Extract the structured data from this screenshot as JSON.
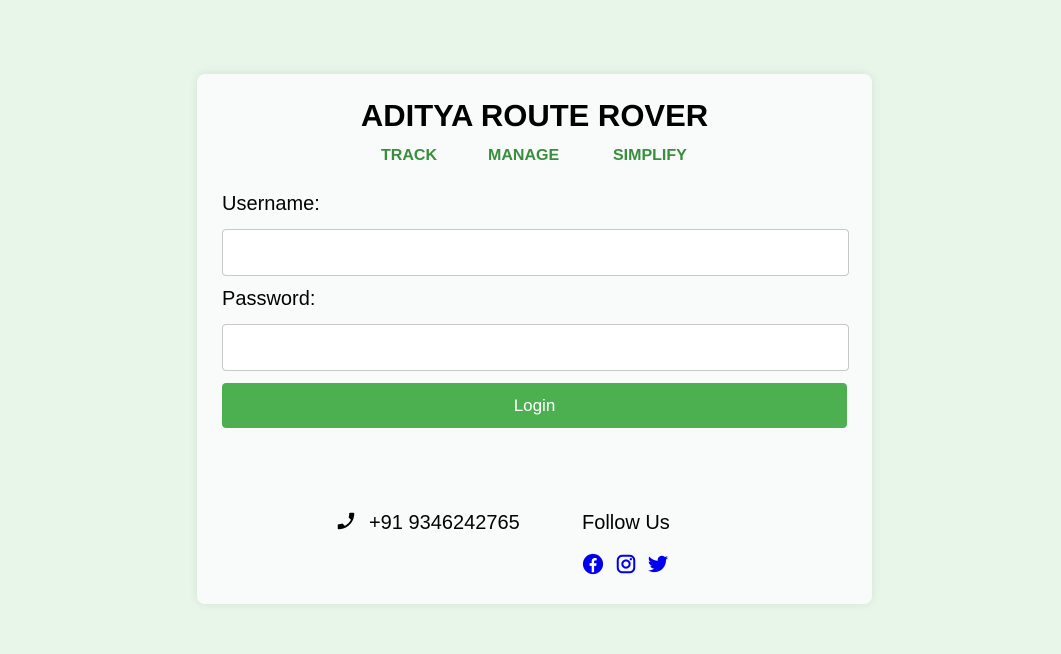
{
  "header": {
    "title": "ADITYA ROUTE ROVER",
    "tagline": [
      "TRACK",
      "MANAGE",
      "SIMPLIFY"
    ]
  },
  "form": {
    "username_label": "Username:",
    "username_value": "",
    "password_label": "Password:",
    "password_value": "",
    "login_label": "Login"
  },
  "footer": {
    "phone_icon": "phone-icon",
    "phone": "+91 9346242765",
    "follow_label": "Follow Us",
    "social_icons": [
      "facebook-icon",
      "instagram-icon",
      "twitter-icon"
    ]
  },
  "colors": {
    "background": "#e8f5e9",
    "card": "#f9fbfa",
    "accent_green": "#4caf50",
    "tagline_green": "#388e3c",
    "social_blue": "#0000ee"
  }
}
